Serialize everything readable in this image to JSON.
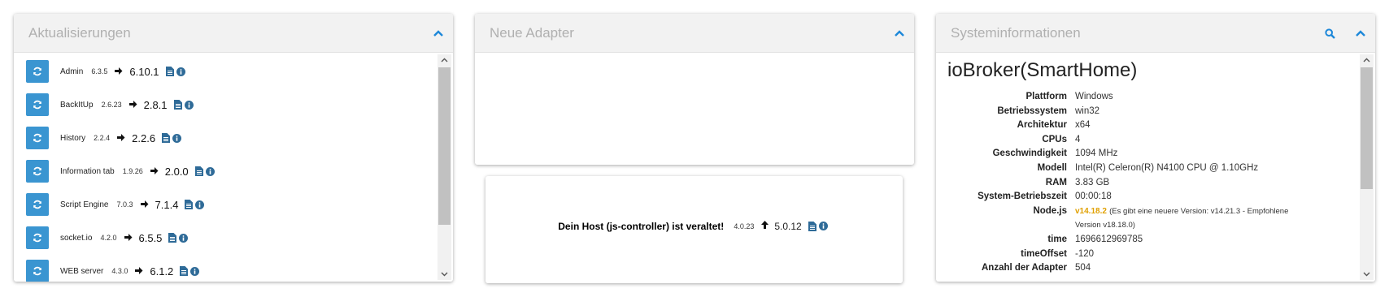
{
  "updates_panel": {
    "title": "Aktualisierungen",
    "items": [
      {
        "name": "Admin",
        "installed": "6.3.5",
        "available": "6.10.1"
      },
      {
        "name": "BackItUp",
        "installed": "2.6.23",
        "available": "2.8.1"
      },
      {
        "name": "History",
        "installed": "2.2.4",
        "available": "2.2.6"
      },
      {
        "name": "Information tab",
        "installed": "1.9.26",
        "available": "2.0.0"
      },
      {
        "name": "Script Engine",
        "installed": "7.0.3",
        "available": "7.1.4"
      },
      {
        "name": "socket.io",
        "installed": "4.2.0",
        "available": "6.5.5"
      },
      {
        "name": "WEB server",
        "installed": "4.3.0",
        "available": "6.1.2"
      }
    ]
  },
  "new_adapters_panel": {
    "title": "Neue Adapter"
  },
  "host_panel": {
    "message": "Dein Host (js-controller) ist veraltet!",
    "installed": "4.0.23",
    "available": "5.0.12"
  },
  "system_panel": {
    "title": "Systeminformationen",
    "host_name": "ioBroker(SmartHome)",
    "rows": [
      {
        "label": "Plattform",
        "value": "Windows"
      },
      {
        "label": "Betriebssystem",
        "value": "win32"
      },
      {
        "label": "Architektur",
        "value": "x64"
      },
      {
        "label": "CPUs",
        "value": "4"
      },
      {
        "label": "Geschwindigkeit",
        "value": "1094 MHz"
      },
      {
        "label": "Modell",
        "value": "Intel(R) Celeron(R) N4100 CPU @ 1.10GHz"
      },
      {
        "label": "RAM",
        "value": "3.83 GB"
      },
      {
        "label": "System-Betriebszeit",
        "value": "00:00:18"
      }
    ],
    "node": {
      "label": "Node.js",
      "version": "v14.18.2",
      "note": "(Es gibt eine neuere Version: v14.21.3 - Empfohlene Version v18.18.0)"
    },
    "rows_after": [
      {
        "label": "time",
        "value": "1696612969785"
      },
      {
        "label": "timeOffset",
        "value": "-120"
      },
      {
        "label": "Anzahl der Adapter",
        "value": "504"
      }
    ]
  },
  "colors": {
    "accent": "#1e88d9",
    "update_button": "#3a95d1",
    "node_version": "#e0a000",
    "header_bg": "#f2f2f2",
    "header_text": "#b0b0b0"
  }
}
